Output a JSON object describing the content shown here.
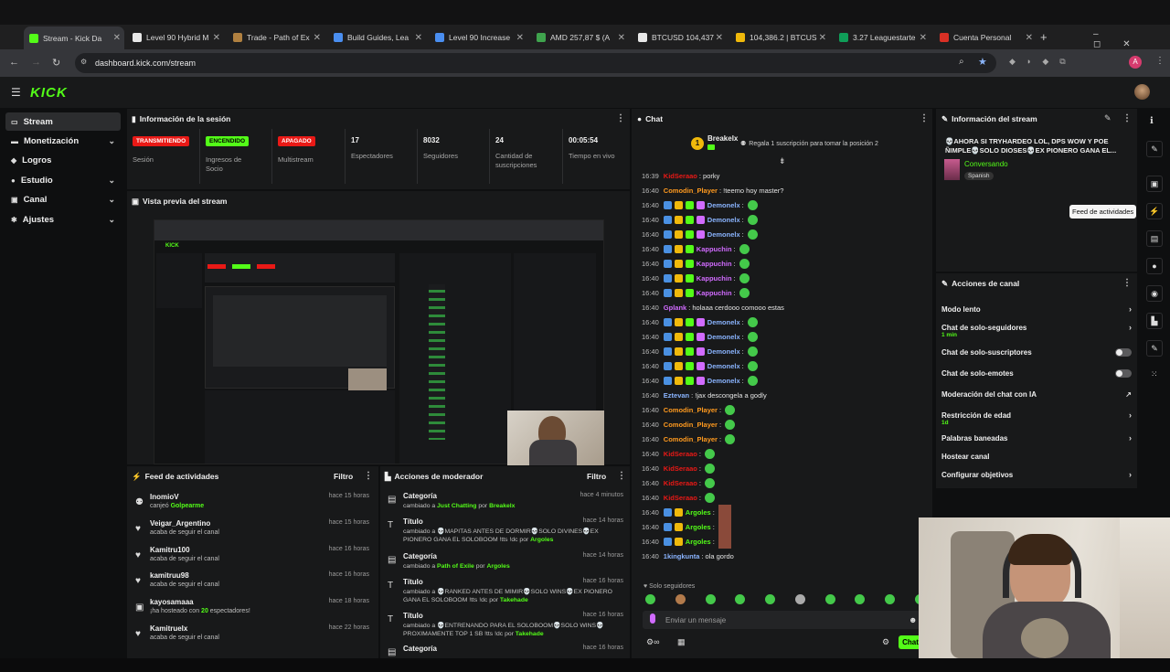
{
  "browser": {
    "tabs": [
      {
        "label": "Stream - Kick Da",
        "color": "#53fc18",
        "active": true
      },
      {
        "label": "Level 90 Hybrid M",
        "color": "#e8e8e8"
      },
      {
        "label": "Trade - Path of Ex",
        "color": "#b08040"
      },
      {
        "label": "Build Guides, Lea",
        "color": "#4a8ef0"
      },
      {
        "label": "Level 90 Increase",
        "color": "#4a8ef0"
      },
      {
        "label": "AMD 257,87 $ (A",
        "color": "#3fa34d"
      },
      {
        "label": "BTCUSD 104,437",
        "color": "#e8e8e8"
      },
      {
        "label": "104,386.2 | BTCUS",
        "color": "#f0b90b"
      },
      {
        "label": "3.27 Leaguestarte",
        "color": "#0f9d58"
      },
      {
        "label": "Cuenta Personal",
        "color": "#d93025"
      }
    ],
    "url": "dashboard.kick.com/stream"
  },
  "logo": "KICK",
  "sidebar": {
    "items": [
      {
        "label": "Stream",
        "icon": "stream-icon",
        "chevron": false
      },
      {
        "label": "Monetización",
        "icon": "money-icon",
        "chevron": true
      },
      {
        "label": "Logros",
        "icon": "achievement-icon",
        "chevron": false
      },
      {
        "label": "Estudio",
        "icon": "studio-icon",
        "chevron": true
      },
      {
        "label": "Canal",
        "icon": "channel-icon",
        "chevron": true
      },
      {
        "label": "Ajustes",
        "icon": "settings-icon",
        "chevron": true
      }
    ]
  },
  "session": {
    "title": "Información de la sesión",
    "stats": [
      {
        "value": "TRANSMITIENDO",
        "label": "Sesión",
        "badge": "#e91916"
      },
      {
        "value": "ENCENDIDO",
        "label": "Ingresos de Socio",
        "badge": "#53fc18"
      },
      {
        "value": "APAGADO",
        "label": "Multistream",
        "badge": "#e91916"
      },
      {
        "value": "17",
        "label": "Espectadores"
      },
      {
        "value": "8032",
        "label": "Seguidores"
      },
      {
        "value": "24",
        "label": "Cantidad de suscripciones"
      },
      {
        "value": "00:05:54",
        "label": "Tiempo en vivo"
      }
    ]
  },
  "preview": {
    "title": "Vista previa del stream"
  },
  "feed": {
    "title": "Feed de actividades",
    "filter": "Filtro",
    "items": [
      {
        "name": "InomioV",
        "desc": "canjeó ",
        "hl": "Golpearme",
        "time": "hace 15 horas",
        "icon": "redeem-icon"
      },
      {
        "name": "Veigar_Argentino",
        "desc": "acaba de seguir el canal",
        "time": "hace 15 horas",
        "icon": "heart-icon"
      },
      {
        "name": "Kamitru100",
        "desc": "acaba de seguir el canal",
        "time": "hace 16 horas",
        "icon": "heart-icon"
      },
      {
        "name": "kamitruu98",
        "desc": "acaba de seguir el canal",
        "time": "hace 16 horas",
        "icon": "heart-icon"
      },
      {
        "name": "kayosamaaa",
        "desc": "¡ha hosteado con ",
        "hl": "20",
        "desc2": " espectadores!",
        "time": "hace 18 horas",
        "icon": "host-icon"
      },
      {
        "name": "Kamitruelx",
        "desc": "acaba de seguir el canal",
        "time": "hace 22 horas",
        "icon": "heart-icon"
      }
    ]
  },
  "mod": {
    "title": "Acciones de moderador",
    "filter": "Filtro",
    "items": [
      {
        "name": "Categoría",
        "desc": "cambiado a ",
        "hl": "Just Chatting",
        "by": "Breakelx",
        "time": "hace 4 minutos"
      },
      {
        "name": "Título",
        "desc": "cambiado a 💀MAPITAS ANTES DE DORMIR💀SOLO DIVINES💀EX PIONERO GANA EL SOLOBOOM !tts !dc",
        "by": "Argoles",
        "time": "hace 14 horas"
      },
      {
        "name": "Categoría",
        "desc": "cambiado a ",
        "hl": "Path of Exile",
        "by": "Argoles",
        "time": "hace 14 horas"
      },
      {
        "name": "Título",
        "desc": "cambiado a 💀RANKED ANTES DE MIMIR💀SOLO WINS💀EX PIONERO GANA EL SOLOBOOM !tts !dc",
        "by": "Takehade",
        "time": "hace 16 horas"
      },
      {
        "name": "Título",
        "desc": "cambiado a 💀ENTRENANDO PARA EL SOLOBOOM💀SOLO WINS💀 PROXIMAMENTE TOP 1 SB !tts !dc",
        "by": "Takehade",
        "time": "hace 16 horas"
      },
      {
        "name": "Categoría",
        "desc": "",
        "time": "hace 16 horas"
      }
    ],
    "por": "por"
  },
  "chat": {
    "title": "Chat",
    "gift_user": "Breakelx",
    "gift_rank": "1",
    "gift_text": "Regala 1 suscripción para tomar la posición 2",
    "lines": [
      {
        "t": "16:39",
        "u": "KidSeraao",
        "c": "#e91916",
        "m": ": porky",
        "b": 0,
        "e": 0
      },
      {
        "t": "16:40",
        "u": "Comodin_Player",
        "c": "#ff9a1f",
        "m": ": !teemo hoy master?",
        "b": 0,
        "e": 0
      },
      {
        "t": "16:40",
        "u": "Demonelx",
        "c": "#8ab4ff",
        "m": ":",
        "b": 4,
        "e": 1
      },
      {
        "t": "16:40",
        "u": "Demonelx",
        "c": "#8ab4ff",
        "m": ":",
        "b": 4,
        "e": 1
      },
      {
        "t": "16:40",
        "u": "Demonelx",
        "c": "#8ab4ff",
        "m": ":",
        "b": 4,
        "e": 1
      },
      {
        "t": "16:40",
        "u": "Kappuchin",
        "c": "#d16bff",
        "m": ":",
        "b": 3,
        "e": 1
      },
      {
        "t": "16:40",
        "u": "Kappuchin",
        "c": "#d16bff",
        "m": ":",
        "b": 3,
        "e": 1
      },
      {
        "t": "16:40",
        "u": "Kappuchin",
        "c": "#d16bff",
        "m": ":",
        "b": 3,
        "e": 1
      },
      {
        "t": "16:40",
        "u": "Kappuchin",
        "c": "#d16bff",
        "m": ":",
        "b": 3,
        "e": 1
      },
      {
        "t": "16:40",
        "u": "Gplank",
        "c": "#d16bff",
        "m": ": holaaa cerdooo comooo estas",
        "b": 0,
        "e": 0
      },
      {
        "t": "16:40",
        "u": "Demonelx",
        "c": "#8ab4ff",
        "m": ":",
        "b": 4,
        "e": 1
      },
      {
        "t": "16:40",
        "u": "Demonelx",
        "c": "#8ab4ff",
        "m": ":",
        "b": 4,
        "e": 1
      },
      {
        "t": "16:40",
        "u": "Demonelx",
        "c": "#8ab4ff",
        "m": ":",
        "b": 4,
        "e": 1
      },
      {
        "t": "16:40",
        "u": "Demonelx",
        "c": "#8ab4ff",
        "m": ":",
        "b": 4,
        "e": 1
      },
      {
        "t": "16:40",
        "u": "Demonelx",
        "c": "#8ab4ff",
        "m": ":",
        "b": 4,
        "e": 1
      },
      {
        "t": "16:40",
        "u": "Eztevan",
        "c": "#8ab4ff",
        "m": ": !jax descongela a godly",
        "b": 0,
        "e": 0
      },
      {
        "t": "16:40",
        "u": "Comodin_Player",
        "c": "#ff9a1f",
        "m": ":",
        "b": 0,
        "e": 1
      },
      {
        "t": "16:40",
        "u": "Comodin_Player",
        "c": "#ff9a1f",
        "m": ":",
        "b": 0,
        "e": 1
      },
      {
        "t": "16:40",
        "u": "Comodin_Player",
        "c": "#ff9a1f",
        "m": ":",
        "b": 0,
        "e": 1
      },
      {
        "t": "16:40",
        "u": "KidSeraao",
        "c": "#e91916",
        "m": ":",
        "b": 0,
        "e": 1
      },
      {
        "t": "16:40",
        "u": "KidSeraao",
        "c": "#e91916",
        "m": ":",
        "b": 0,
        "e": 1
      },
      {
        "t": "16:40",
        "u": "KidSeraao",
        "c": "#e91916",
        "m": ":",
        "b": 0,
        "e": 1
      },
      {
        "t": "16:40",
        "u": "KidSeraao",
        "c": "#e91916",
        "m": ":",
        "b": 0,
        "e": 1
      },
      {
        "t": "16:40",
        "u": "Argoles",
        "c": "#53fc18",
        "m": ":",
        "b": 2,
        "e": 2
      },
      {
        "t": "16:40",
        "u": "Argoles",
        "c": "#53fc18",
        "m": ":",
        "b": 2,
        "e": 2
      },
      {
        "t": "16:40",
        "u": "Argoles",
        "c": "#53fc18",
        "m": ":",
        "b": 2,
        "e": 2
      },
      {
        "t": "16:40",
        "u": "1kingkunta",
        "c": "#8ab4ff",
        "m": ": ola gordo",
        "b": 0,
        "e": 0
      }
    ],
    "followers_only": "Solo seguidores",
    "input_placeholder": "Enviar un mensaje",
    "send_label": "Chat"
  },
  "stream_info": {
    "title": "Información del stream",
    "stream_title": "💀AHORA SI TRYHARDEO LOL, DPS WOW Y POE ÑIMPLE💀SOLO DIOSES💀EX PIONERO GANA EL...",
    "category": "Conversando",
    "language": "Spanish"
  },
  "channel_actions": {
    "title": "Acciones de canal",
    "items": [
      {
        "label": "Modo lento",
        "type": "arrow"
      },
      {
        "label": "Chat de solo-seguidores",
        "sub": "1 min",
        "type": "arrow"
      },
      {
        "label": "Chat de solo-suscriptores",
        "type": "toggle"
      },
      {
        "label": "Chat de solo-emotes",
        "type": "toggle"
      },
      {
        "label": "Moderación del chat con IA",
        "type": "ext"
      },
      {
        "label": "Restricción de edad",
        "sub": "1d",
        "type": "arrow"
      },
      {
        "label": "Palabras baneadas",
        "type": "arrow"
      },
      {
        "label": "Hostear canal",
        "type": "none"
      },
      {
        "label": "Configurar objetivos",
        "type": "arrow"
      }
    ]
  },
  "tooltip": "Feed de actividades",
  "colors": {
    "accent": "#53fc18",
    "live": "#e91916",
    "panel": "#18191a"
  }
}
